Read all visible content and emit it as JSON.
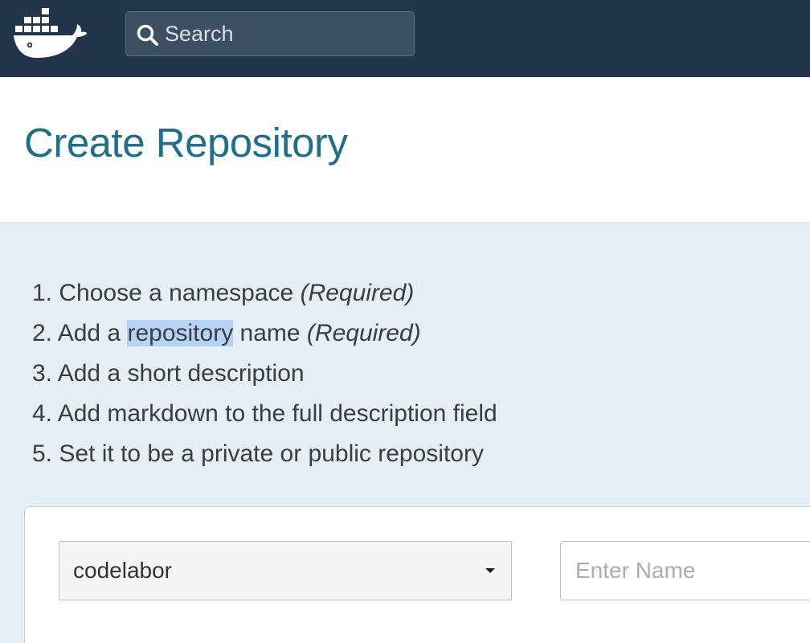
{
  "header": {
    "logo_icon": "docker-whale-logo-icon",
    "search": {
      "icon": "search-icon",
      "placeholder": "Search",
      "value": ""
    }
  },
  "page": {
    "title": "Create Repository"
  },
  "steps": [
    {
      "number": "1.",
      "before": "Choose a namespace",
      "highlight": "",
      "after": "",
      "required": "(Required)"
    },
    {
      "number": "2.",
      "before": "Add a",
      "highlight": "repository",
      "after": "name",
      "required": "(Required)"
    },
    {
      "number": "3.",
      "before": "Add a short description",
      "highlight": "",
      "after": "",
      "required": ""
    },
    {
      "number": "4.",
      "before": "Add markdown to the full description field",
      "highlight": "",
      "after": "",
      "required": ""
    },
    {
      "number": "5.",
      "before": "Set it to be a private or public repository",
      "highlight": "",
      "after": "",
      "required": ""
    }
  ],
  "form": {
    "namespace": {
      "selected": "codelabor",
      "icon": "caret-down-icon"
    },
    "name": {
      "placeholder": "Enter Name",
      "value": ""
    }
  },
  "colors": {
    "navbar": "#22354a",
    "title": "#1d7089",
    "band": "#e5edf5",
    "selection_highlight": "#b4d3f5"
  }
}
